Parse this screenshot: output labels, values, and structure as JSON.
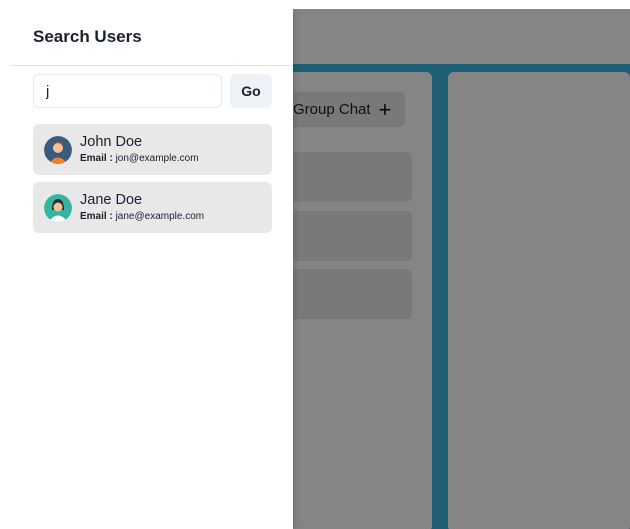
{
  "drawer": {
    "title": "Search Users",
    "search": {
      "value": "j",
      "placeholder": "Search by name or email"
    },
    "go_label": "Go",
    "email_label": "Email : ",
    "results": [
      {
        "name": "John Doe",
        "email": "jon@example.com",
        "avatar": "man-avatar-icon"
      },
      {
        "name": "Jane Doe",
        "email": "jane@example.com",
        "avatar": "woman-avatar-icon"
      }
    ]
  },
  "background": {
    "group_chat_label": "Group Chat"
  },
  "colors": {
    "accent_blue": "#3cb7e6",
    "overlay": "rgba(0,0,0,0.48)",
    "item_bg": "#e8e8e8"
  }
}
